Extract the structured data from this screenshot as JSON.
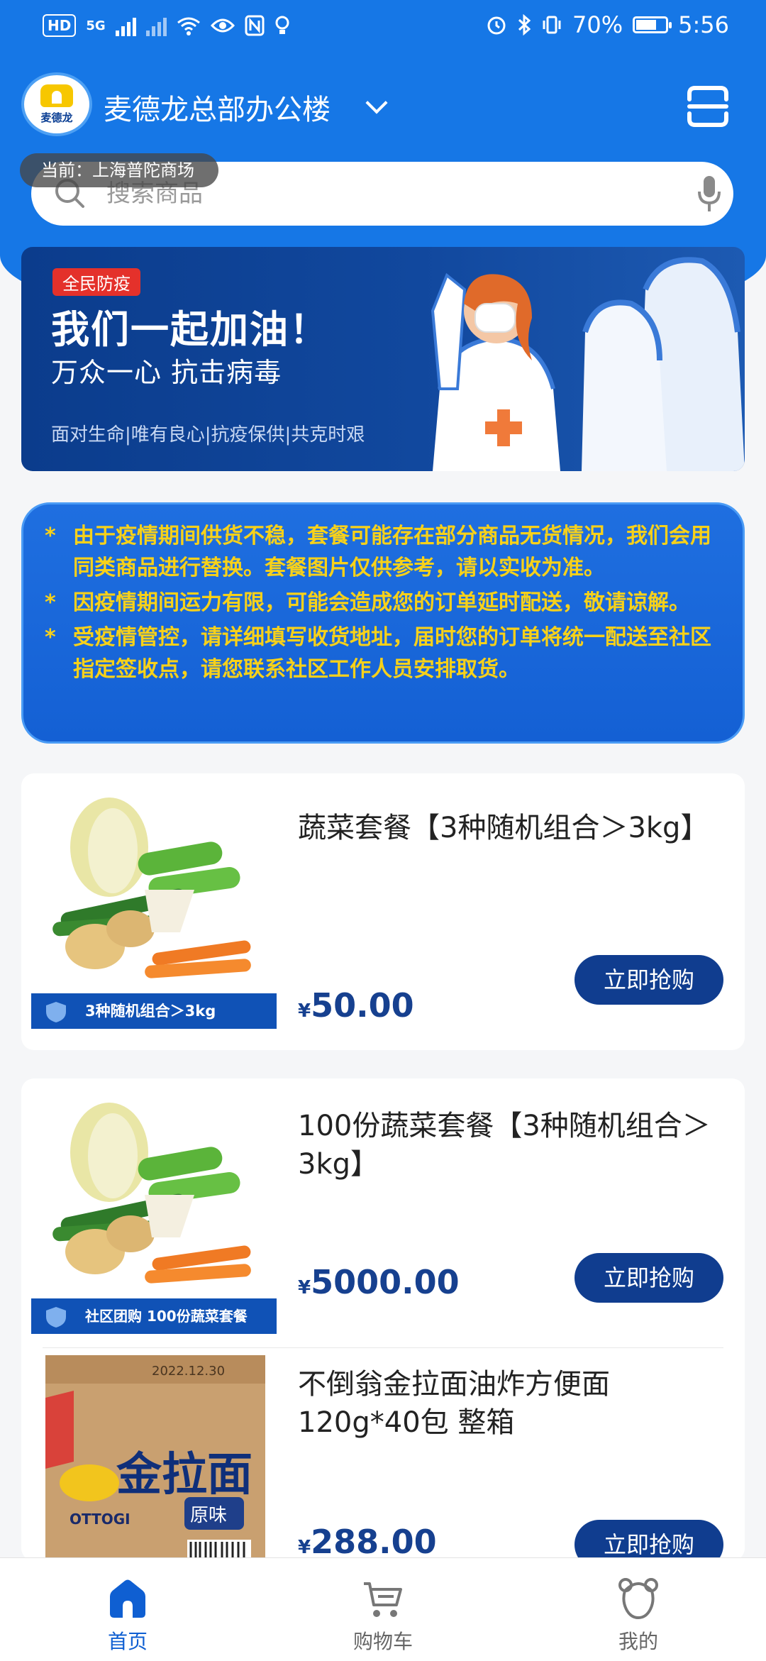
{
  "status_bar": {
    "left_chips": [
      "HD",
      "5G"
    ],
    "battery": "70%",
    "time": "5:56"
  },
  "header": {
    "brand": "麦德龙",
    "store_name": "麦德龙总部办公楼",
    "current_store": "当前：上海普陀商场"
  },
  "search": {
    "placeholder": "搜索商品"
  },
  "banner": {
    "tag": "全民防疫",
    "title": "我们一起加油！",
    "subtitle": "万众一心 抗击病毒",
    "footer": "面对生命|唯有良心|抗疫保供|共克时艰"
  },
  "notice": {
    "items": [
      "由于疫情期间供货不稳，套餐可能存在部分商品无货情况，我们会用同类商品进行替换。套餐图片仅供参考，请以实收为准。",
      "因疫情期间运力有限，可能会造成您的订单延时配送，敬请谅解。",
      "受疫情管控，请详细填写收货地址，届时您的订单将统一配送至社区指定签收点，请您联系社区工作人员安排取货。"
    ]
  },
  "products": [
    {
      "title": "蔬菜套餐【3种随机组合＞3kg】",
      "currency": "¥",
      "price": "50.00",
      "image_label": "3种随机组合＞3kg",
      "buy_label": "立即抢购"
    },
    {
      "title": "100份蔬菜套餐【3种随机组合＞3kg】",
      "currency": "¥",
      "price": "5000.00",
      "image_label": "社区团购 100份蔬菜套餐",
      "buy_label": "立即抢购"
    },
    {
      "title": "不倒翁金拉面油炸方便面120g*40包 整箱",
      "currency": "¥",
      "price": "288.00",
      "box_text": "金拉面",
      "box_flavor": "原味",
      "box_brand": "OTTOGI",
      "box_date": "2022.12.30",
      "buy_label": "立即抢购"
    }
  ],
  "tabbar": {
    "tabs": [
      {
        "label": "首页",
        "active": true
      },
      {
        "label": "购物车",
        "active": false
      },
      {
        "label": "我的",
        "active": false
      }
    ]
  },
  "colors": {
    "primary": "#1677e6",
    "dark_blue": "#103d8f",
    "notice_text": "#f7d11a",
    "price": "#16408f",
    "tag_red": "#e4312b"
  }
}
